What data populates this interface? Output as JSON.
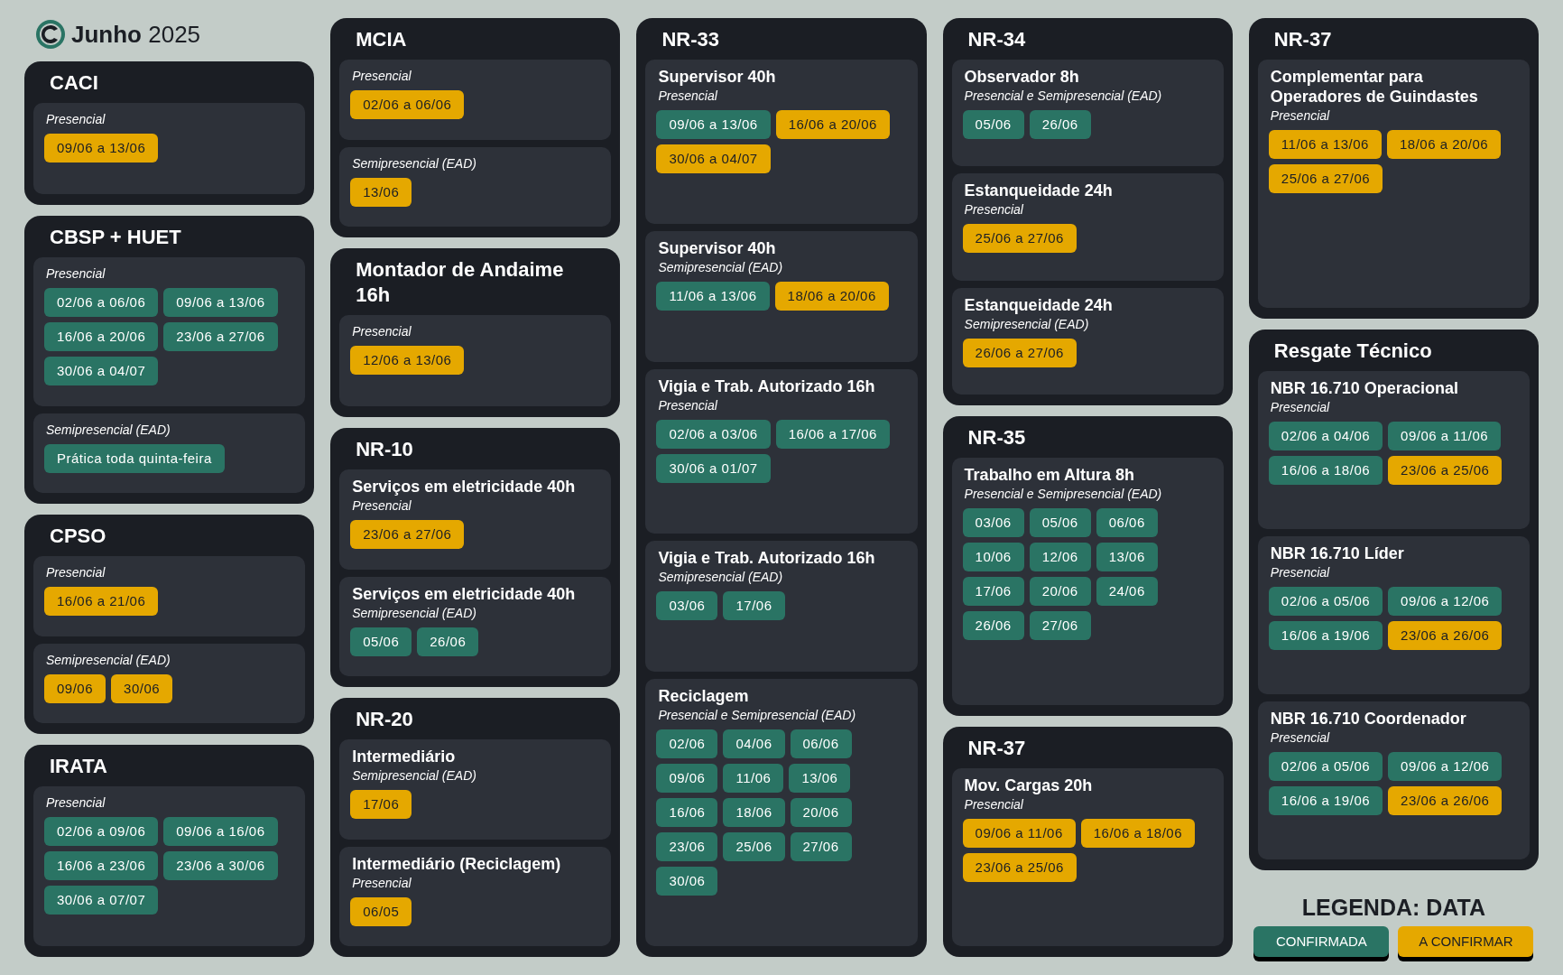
{
  "header": {
    "month": "Junho",
    "year": "2025"
  },
  "columns": [
    {
      "cards": [
        {
          "title": "CACI",
          "sections": [
            {
              "mode": "Presencial",
              "dates": [
                {
                  "text": "09/06 a 13/06",
                  "confirmed": false
                }
              ]
            }
          ]
        },
        {
          "title": "CBSP + HUET",
          "sections": [
            {
              "mode": "Presencial",
              "dates": [
                {
                  "text": "02/06 a 06/06",
                  "confirmed": true
                },
                {
                  "text": "09/06 a 13/06",
                  "confirmed": true
                },
                {
                  "text": "16/06 a 20/06",
                  "confirmed": true
                },
                {
                  "text": "23/06 a 27/06",
                  "confirmed": true
                },
                {
                  "text": "30/06 a 04/07",
                  "confirmed": true
                }
              ]
            },
            {
              "mode": "Semipresencial (EAD)",
              "dates": [
                {
                  "text": "Prática toda quinta-feira",
                  "confirmed": true
                }
              ]
            }
          ]
        },
        {
          "title": "CPSO",
          "sections": [
            {
              "mode": "Presencial",
              "dates": [
                {
                  "text": "16/06 a 21/06",
                  "confirmed": false
                }
              ]
            },
            {
              "mode": "Semipresencial (EAD)",
              "dates": [
                {
                  "text": "09/06",
                  "confirmed": false
                },
                {
                  "text": "30/06",
                  "confirmed": false
                }
              ]
            }
          ]
        },
        {
          "title": "IRATA",
          "sections": [
            {
              "mode": "Presencial",
              "dates": [
                {
                  "text": "02/06 a 09/06",
                  "confirmed": true
                },
                {
                  "text": "09/06 a 16/06",
                  "confirmed": true
                },
                {
                  "text": "16/06 a 23/06",
                  "confirmed": true
                },
                {
                  "text": "23/06 a 30/06",
                  "confirmed": true
                },
                {
                  "text": "30/06 a 07/07",
                  "confirmed": true
                }
              ]
            }
          ]
        }
      ]
    },
    {
      "cards": [
        {
          "title": "MCIA",
          "sections": [
            {
              "mode": "Presencial",
              "dates": [
                {
                  "text": "02/06 a 06/06",
                  "confirmed": false
                }
              ]
            },
            {
              "mode": "Semipresencial (EAD)",
              "dates": [
                {
                  "text": "13/06",
                  "confirmed": false
                }
              ]
            }
          ]
        },
        {
          "title": "Montador de Andaime 16h",
          "sections": [
            {
              "mode": "Presencial",
              "dates": [
                {
                  "text": "12/06 a 13/06",
                  "confirmed": false
                }
              ]
            }
          ]
        },
        {
          "title": "NR-10",
          "sections": [
            {
              "heading": "Serviços em eletricidade 40h",
              "mode": "Presencial",
              "dates": [
                {
                  "text": "23/06 a 27/06",
                  "confirmed": false
                }
              ]
            },
            {
              "heading": "Serviços em eletricidade 40h",
              "mode": "Semipresencial (EAD)",
              "dates": [
                {
                  "text": "05/06",
                  "confirmed": true
                },
                {
                  "text": "26/06",
                  "confirmed": true
                }
              ]
            }
          ]
        },
        {
          "title": "NR-20",
          "sections": [
            {
              "heading": "Intermediário",
              "mode": "Semipresencial (EAD)",
              "dates": [
                {
                  "text": "17/06",
                  "confirmed": false
                }
              ]
            },
            {
              "heading": "Intermediário (Reciclagem)",
              "mode": "Presencial",
              "dates": [
                {
                  "text": "06/05",
                  "confirmed": false
                }
              ]
            }
          ]
        }
      ]
    },
    {
      "cards": [
        {
          "title": "NR-33",
          "sections": [
            {
              "heading": "Supervisor 40h",
              "mode": "Presencial",
              "dates": [
                {
                  "text": "09/06 a 13/06",
                  "confirmed": true
                },
                {
                  "text": "16/06 a 20/06",
                  "confirmed": false
                },
                {
                  "text": "30/06 a 04/07",
                  "confirmed": false
                }
              ]
            },
            {
              "heading": "Supervisor 40h",
              "mode": "Semipresencial (EAD)",
              "dates": [
                {
                  "text": "11/06 a 13/06",
                  "confirmed": true
                },
                {
                  "text": "18/06 a 20/06",
                  "confirmed": false
                }
              ]
            },
            {
              "heading": "Vigia e Trab. Autorizado 16h",
              "mode": "Presencial",
              "dates": [
                {
                  "text": "02/06 a 03/06",
                  "confirmed": true
                },
                {
                  "text": "16/06 a 17/06",
                  "confirmed": true
                },
                {
                  "text": "30/06 a 01/07",
                  "confirmed": true
                }
              ]
            },
            {
              "heading": "Vigia e Trab. Autorizado 16h",
              "mode": "Semipresencial (EAD)",
              "dates": [
                {
                  "text": "03/06",
                  "confirmed": true
                },
                {
                  "text": "17/06",
                  "confirmed": true
                }
              ]
            },
            {
              "heading": "Reciclagem",
              "mode": "Presencial e Semipresencial (EAD)",
              "dates": [
                {
                  "text": "02/06",
                  "confirmed": true
                },
                {
                  "text": "04/06",
                  "confirmed": true
                },
                {
                  "text": "06/06",
                  "confirmed": true
                },
                {
                  "text": "09/06",
                  "confirmed": true
                },
                {
                  "text": "11/06",
                  "confirmed": true
                },
                {
                  "text": "13/06",
                  "confirmed": true
                },
                {
                  "text": "16/06",
                  "confirmed": true
                },
                {
                  "text": "18/06",
                  "confirmed": true
                },
                {
                  "text": "20/06",
                  "confirmed": true
                },
                {
                  "text": "23/06",
                  "confirmed": true
                },
                {
                  "text": "25/06",
                  "confirmed": true
                },
                {
                  "text": "27/06",
                  "confirmed": true
                },
                {
                  "text": "30/06",
                  "confirmed": true
                }
              ]
            }
          ]
        }
      ]
    },
    {
      "cards": [
        {
          "title": "NR-34",
          "sections": [
            {
              "heading": "Observador 8h",
              "mode": "Presencial e Semipresencial (EAD)",
              "dates": [
                {
                  "text": "05/06",
                  "confirmed": true
                },
                {
                  "text": "26/06",
                  "confirmed": true
                }
              ]
            },
            {
              "heading": "Estanqueidade 24h",
              "mode": "Presencial",
              "dates": [
                {
                  "text": "25/06 a 27/06",
                  "confirmed": false
                }
              ]
            },
            {
              "heading": "Estanqueidade 24h",
              "mode": "Semipresencial (EAD)",
              "dates": [
                {
                  "text": "26/06 a 27/06",
                  "confirmed": false
                }
              ]
            }
          ]
        },
        {
          "title": "NR-35",
          "sections": [
            {
              "heading": "Trabalho em Altura 8h",
              "mode": "Presencial e Semipresencial (EAD)",
              "dates": [
                {
                  "text": "03/06",
                  "confirmed": true
                },
                {
                  "text": "05/06",
                  "confirmed": true
                },
                {
                  "text": "06/06",
                  "confirmed": true
                },
                {
                  "text": "10/06",
                  "confirmed": true
                },
                {
                  "text": "12/06",
                  "confirmed": true
                },
                {
                  "text": "13/06",
                  "confirmed": true
                },
                {
                  "text": "17/06",
                  "confirmed": true
                },
                {
                  "text": "20/06",
                  "confirmed": true
                },
                {
                  "text": "24/06",
                  "confirmed": true
                },
                {
                  "text": "26/06",
                  "confirmed": true
                },
                {
                  "text": "27/06",
                  "confirmed": true
                }
              ]
            }
          ]
        },
        {
          "title": "NR-37",
          "sections": [
            {
              "heading": "Mov. Cargas  20h",
              "mode": "Presencial",
              "dates": [
                {
                  "text": "09/06 a 11/06",
                  "confirmed": false
                },
                {
                  "text": "16/06 a 18/06",
                  "confirmed": false
                },
                {
                  "text": "23/06 a 25/06",
                  "confirmed": false
                }
              ]
            }
          ]
        }
      ]
    },
    {
      "cards": [
        {
          "title": "NR-37",
          "sections": [
            {
              "heading": "Complementar para Operadores de Guindastes",
              "mode": "Presencial",
              "dates": [
                {
                  "text": "11/06 a 13/06",
                  "confirmed": false
                },
                {
                  "text": "18/06 a 20/06",
                  "confirmed": false
                },
                {
                  "text": "25/06 a 27/06",
                  "confirmed": false
                }
              ]
            }
          ]
        },
        {
          "title": "Resgate Técnico",
          "sections": [
            {
              "heading": "NBR 16.710 Operacional",
              "mode": "Presencial",
              "dates": [
                {
                  "text": "02/06 a 04/06",
                  "confirmed": true
                },
                {
                  "text": "09/06 a 11/06",
                  "confirmed": true
                },
                {
                  "text": "16/06 a 18/06",
                  "confirmed": true
                },
                {
                  "text": "23/06 a 25/06",
                  "confirmed": false
                }
              ]
            },
            {
              "heading": "NBR 16.710 Líder",
              "mode": "Presencial",
              "dates": [
                {
                  "text": "02/06 a 05/06",
                  "confirmed": true
                },
                {
                  "text": "09/06 a 12/06",
                  "confirmed": true
                },
                {
                  "text": "16/06 a 19/06",
                  "confirmed": true
                },
                {
                  "text": "23/06 a 26/06",
                  "confirmed": false
                }
              ]
            },
            {
              "heading": "NBR 16.710 Coordenador",
              "mode": "Presencial",
              "dates": [
                {
                  "text": "02/06 a 05/06",
                  "confirmed": true
                },
                {
                  "text": "09/06 a 12/06",
                  "confirmed": true
                },
                {
                  "text": "16/06 a 19/06",
                  "confirmed": true
                },
                {
                  "text": "23/06 a 26/06",
                  "confirmed": false
                }
              ]
            }
          ]
        }
      ]
    }
  ],
  "legend": {
    "title": "LEGENDA: DATA",
    "items": [
      {
        "label": "CONFIRMADA",
        "confirmed": true
      },
      {
        "label": "A CONFIRMAR",
        "confirmed": false
      }
    ]
  }
}
